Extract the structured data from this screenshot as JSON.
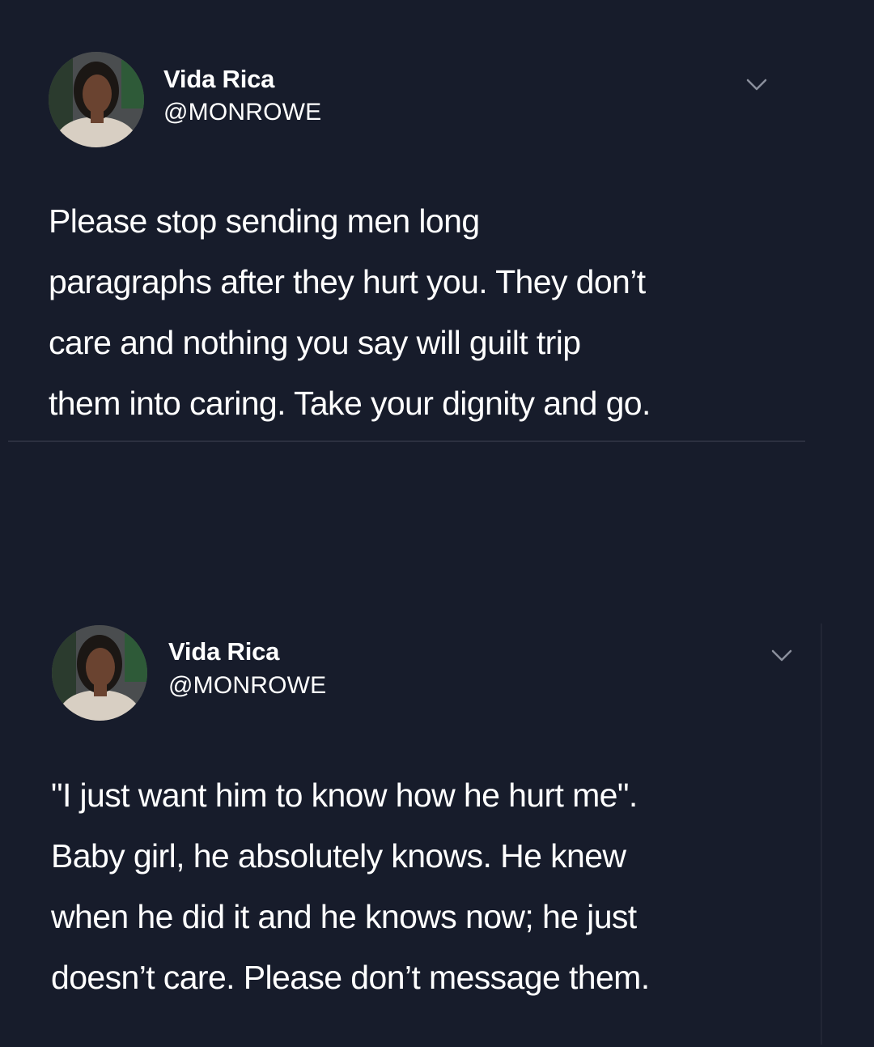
{
  "tweets": [
    {
      "author": "Vida Rica",
      "handle": "@MONROWE",
      "text": "Please stop sending men long\nparagraphs after they hurt you. They don’t\ncare and nothing you say will guilt trip\nthem into caring. Take your dignity and go."
    },
    {
      "author": "Vida Rica",
      "handle": "@MONROWE",
      "text": "\"I just want him to know how he hurt me\".\nBaby girl, he absolutely knows. He knew\nwhen he did it and he knows now; he just\ndoesn’t care. Please don’t message them."
    }
  ],
  "icons": {
    "menu": "chevron-down-icon",
    "avatar": "profile-photo"
  },
  "colors": {
    "background": "#171c2b",
    "text": "#ffffff",
    "divider": "#2c3040"
  }
}
